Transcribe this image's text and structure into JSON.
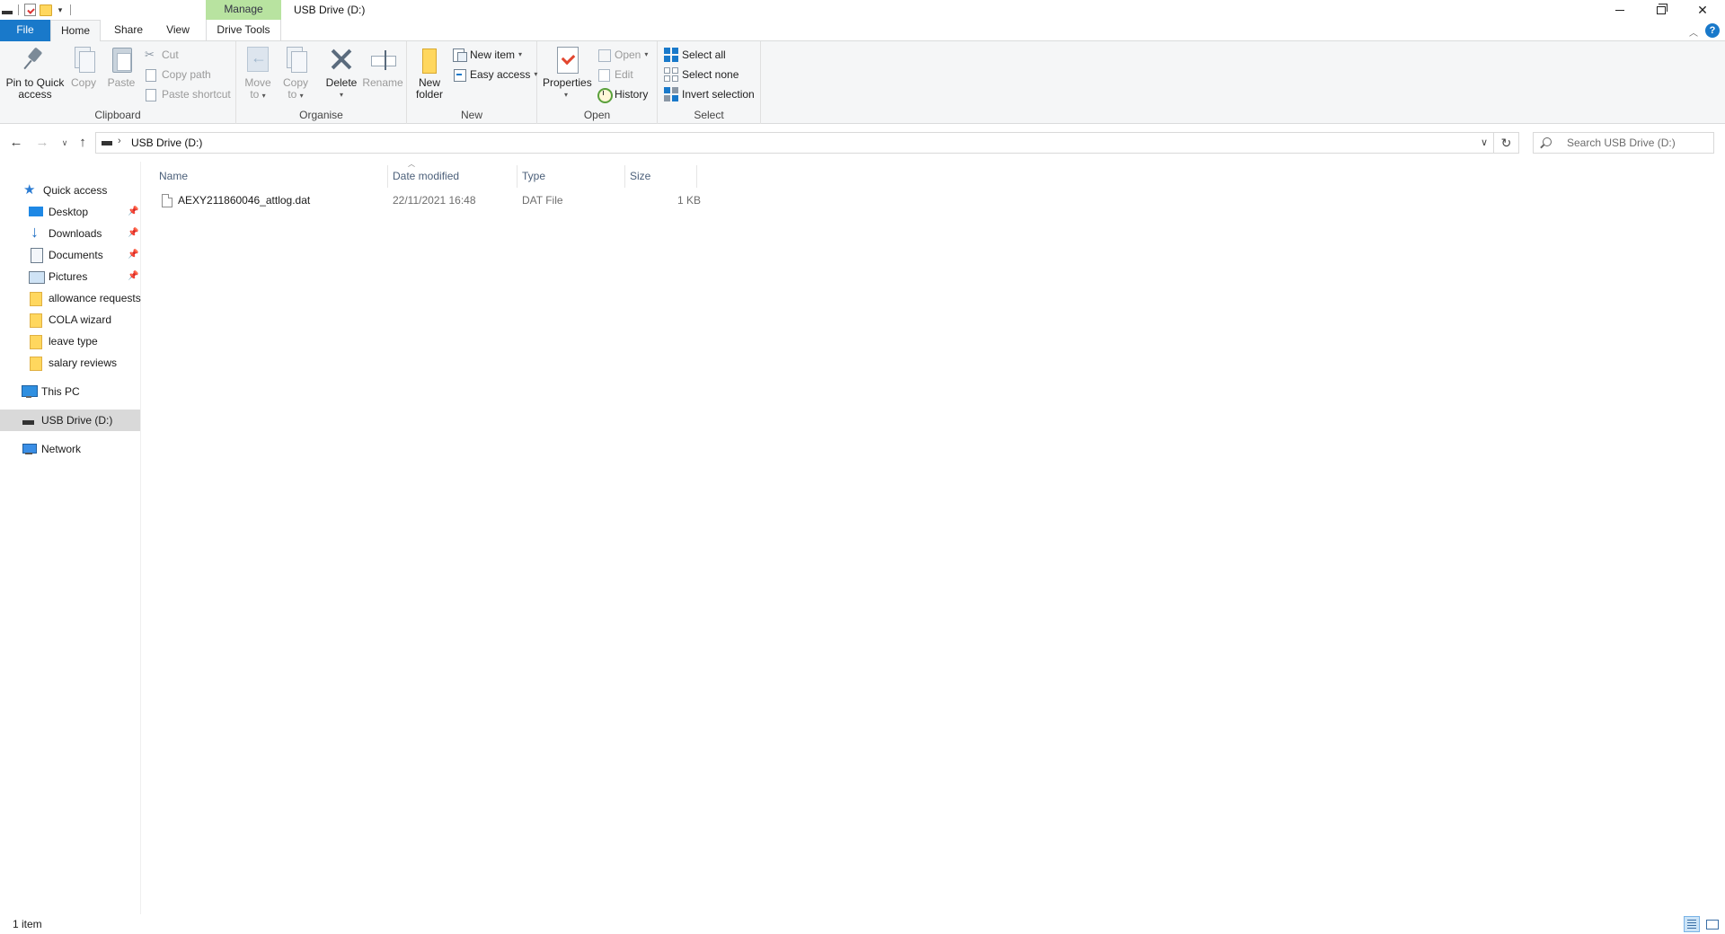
{
  "window": {
    "title": "USB Drive (D:)",
    "context_tab": "Manage"
  },
  "tabs": {
    "file": "File",
    "home": "Home",
    "share": "Share",
    "view": "View",
    "drive_tools": "Drive Tools"
  },
  "ribbon": {
    "clipboard": {
      "label": "Clipboard",
      "pin_line1": "Pin to Quick",
      "pin_line2": "access",
      "copy": "Copy",
      "paste": "Paste",
      "cut": "Cut",
      "copy_path": "Copy path",
      "paste_shortcut": "Paste shortcut"
    },
    "organise": {
      "label": "Organise",
      "move_line1": "Move",
      "move_line2": "to",
      "copy_line1": "Copy",
      "copy_line2": "to",
      "delete": "Delete",
      "rename": "Rename"
    },
    "new": {
      "label": "New",
      "folder_line1": "New",
      "folder_line2": "folder",
      "new_item": "New item",
      "easy_access": "Easy access"
    },
    "open": {
      "label": "Open",
      "properties": "Properties",
      "open": "Open",
      "edit": "Edit",
      "history": "History"
    },
    "select": {
      "label": "Select",
      "select_all": "Select all",
      "select_none": "Select none",
      "invert": "Invert selection"
    }
  },
  "address": {
    "path": "USB Drive (D:)",
    "search_placeholder": "Search USB Drive (D:)"
  },
  "nav": {
    "quick_access": "Quick access",
    "items": [
      {
        "label": "Desktop",
        "icon": "desktop-icon",
        "pinned": true
      },
      {
        "label": "Downloads",
        "icon": "download-icon",
        "pinned": true
      },
      {
        "label": "Documents",
        "icon": "documents-icon",
        "pinned": true
      },
      {
        "label": "Pictures",
        "icon": "pictures-icon",
        "pinned": true
      },
      {
        "label": "allowance requests",
        "icon": "folder-icon",
        "pinned": false
      },
      {
        "label": "COLA wizard",
        "icon": "folder-icon",
        "pinned": false
      },
      {
        "label": "leave type",
        "icon": "folder-icon",
        "pinned": false
      },
      {
        "label": "salary reviews",
        "icon": "folder-icon",
        "pinned": false
      }
    ],
    "this_pc": "This PC",
    "usb_drive": "USB Drive (D:)",
    "network": "Network"
  },
  "columns": {
    "name": "Name",
    "date": "Date modified",
    "type": "Type",
    "size": "Size"
  },
  "files": [
    {
      "name": "AEXY211860046_attlog.dat",
      "date": "22/11/2021 16:48",
      "type": "DAT File",
      "size": "1 KB"
    }
  ],
  "status": {
    "count": "1 item"
  },
  "colors": {
    "accent": "#1979ca",
    "manage_tab": "#b8e3a0",
    "selected_nav": "#d9d9d9"
  }
}
